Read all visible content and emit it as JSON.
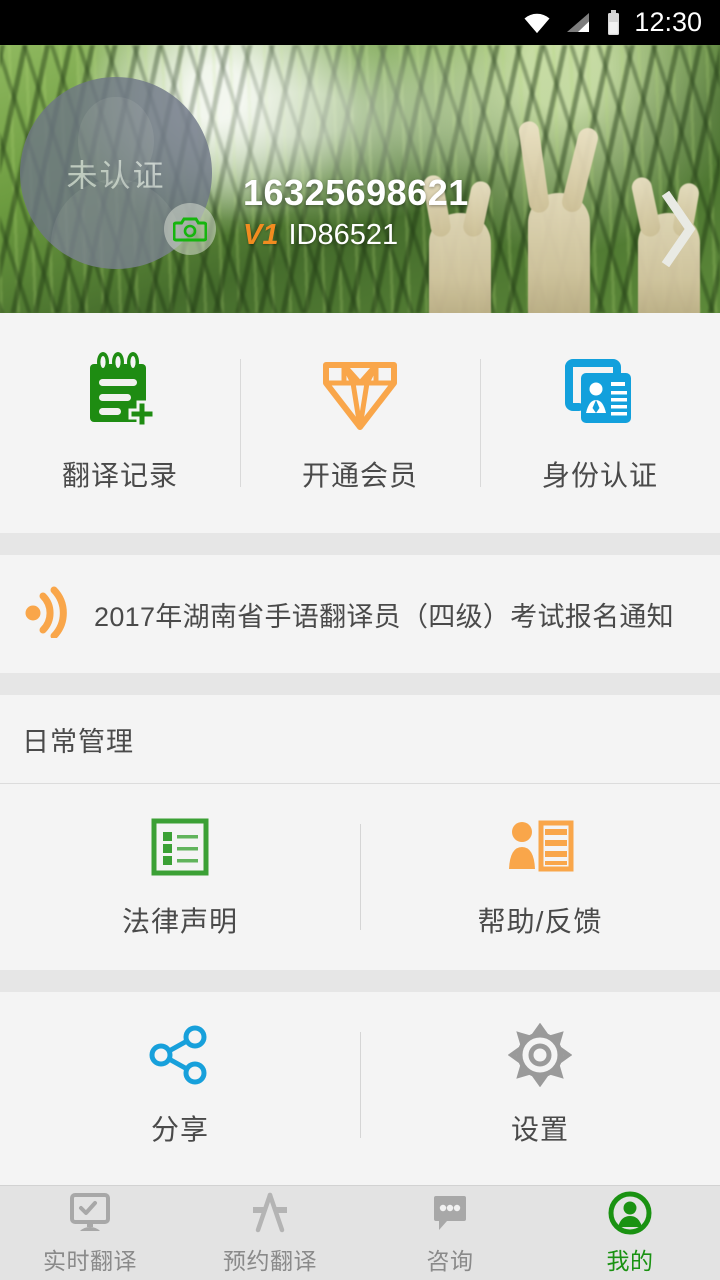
{
  "status_bar": {
    "time": "12:30",
    "icons": [
      "wifi-icon",
      "cellular-signal-icon",
      "battery-icon"
    ]
  },
  "header": {
    "avatar": {
      "label": "未认证",
      "camera_badge_icon": "camera-icon",
      "placeholder_icon": "person-silhouette-icon"
    },
    "phone": "16325698621",
    "level_badge": "V1",
    "user_id": "ID86521",
    "chevron_icon": "chevron-right-icon",
    "background": "forest-hands-photo"
  },
  "quick_actions": [
    {
      "label": "翻译记录",
      "icon": "notepad-plus-icon",
      "color": "#1e8c12"
    },
    {
      "label": "开通会员",
      "icon": "diamond-icon",
      "color": "#f9a64a"
    },
    {
      "label": "身份认证",
      "icon": "id-card-icon",
      "color": "#12a0dc"
    }
  ],
  "notice": {
    "icon": "broadcast-icon",
    "icon_color": "#f9a64a",
    "text": "2017年湖南省手语翻译员（四级）考试报名通知"
  },
  "section": {
    "title": "日常管理",
    "items": [
      {
        "label": "法律声明",
        "icon": "list-document-icon",
        "color": "#3ba035"
      },
      {
        "label": "帮助/反馈",
        "icon": "person-list-icon",
        "color": "#f9a64a"
      }
    ]
  },
  "secondary_items": [
    {
      "label": "分享",
      "icon": "share-nodes-icon",
      "color": "#17a0db"
    },
    {
      "label": "设置",
      "icon": "gear-icon",
      "color": "#9a9a9a"
    }
  ],
  "tabbar": {
    "active_color": "#1a9212",
    "inactive_color": "#a8a8a8",
    "tabs": [
      {
        "label": "实时翻译",
        "icon": "monitor-check-icon",
        "active": false
      },
      {
        "label": "预约翻译",
        "icon": "compass-a-icon",
        "active": false
      },
      {
        "label": "咨询",
        "icon": "chat-bubble-dots-icon",
        "active": false
      },
      {
        "label": "我的",
        "icon": "profile-circle-icon",
        "active": true
      }
    ]
  }
}
